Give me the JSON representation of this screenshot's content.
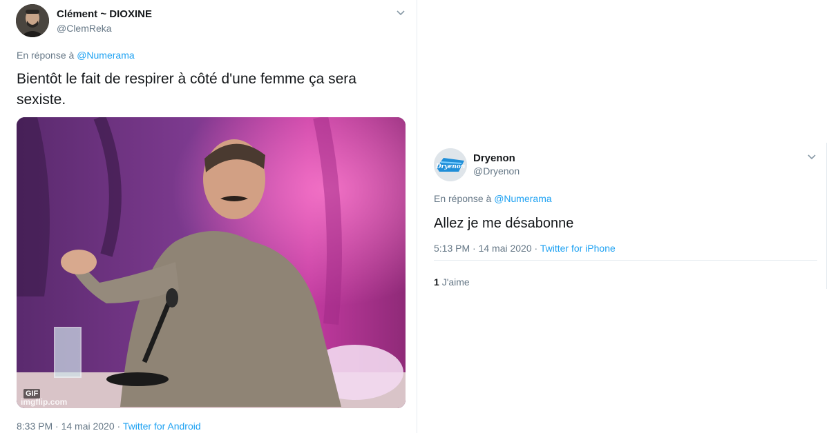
{
  "tweets": [
    {
      "author": {
        "name": "Clément ~ DIOXINE",
        "handle": "@ClemReka"
      },
      "reply_prefix": "En réponse à",
      "reply_to": "@Numerama",
      "text": "Bientôt le fait de respirer à côté d'une femme ça sera sexiste.",
      "media": {
        "badge": "GIF",
        "watermark": "imgflip.com"
      },
      "time": "8:33 PM · 14 mai 2020 ·",
      "source": "Twitter for Android",
      "icons": {
        "avatar": "user-avatar-photo",
        "menu": "chevron-down-icon"
      }
    },
    {
      "author": {
        "name": "Dryenon",
        "handle": "@Dryenon",
        "avatar_logo_text": "Dryenon"
      },
      "reply_prefix": "En réponse à",
      "reply_to": "@Numerama",
      "text": "Allez je me désabonne",
      "time": "5:13 PM · 14 mai 2020 ·",
      "source": "Twitter for iPhone",
      "likes": {
        "count": "1",
        "label": "J'aime"
      },
      "icons": {
        "avatar": "logo-avatar",
        "menu": "chevron-down-icon"
      }
    }
  ],
  "colors": {
    "link": "#1da1f2",
    "secondary_text": "#657786",
    "primary_text": "#14171a",
    "divider": "#e6ecf0"
  }
}
